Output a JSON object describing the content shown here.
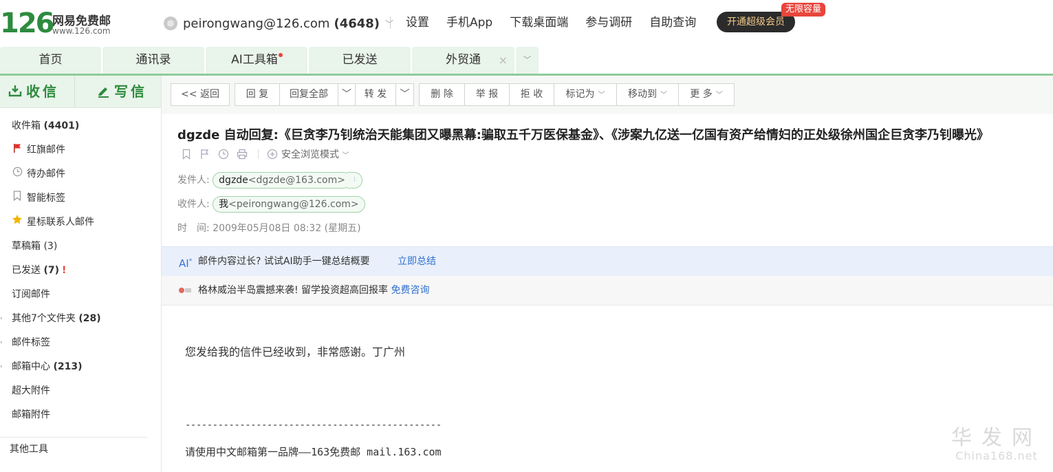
{
  "logo": {
    "number": "126",
    "name": "网易免费邮",
    "url": "www.126.com"
  },
  "account": {
    "email": "peirongwang@126.com",
    "count": "(4648)"
  },
  "top_links": [
    "设置",
    "手机App",
    "下载桌面端",
    "参与调研",
    "自助查询"
  ],
  "vip": {
    "button": "开通超级会员",
    "badge": "无限容量"
  },
  "tabs": [
    {
      "label": "首页"
    },
    {
      "label": "通讯录"
    },
    {
      "label": "AI工具箱"
    },
    {
      "label": "已发送"
    },
    {
      "label": "外贸通"
    }
  ],
  "sidebar": {
    "receive": "收信",
    "write": "写信",
    "items": [
      {
        "label": "收件箱",
        "count": "(4401)"
      },
      {
        "label": "红旗邮件"
      },
      {
        "label": "待办邮件"
      },
      {
        "label": "智能标签"
      },
      {
        "label": "星标联系人邮件"
      },
      {
        "label": "草稿箱",
        "count": "(3)"
      },
      {
        "label": "已发送",
        "count": "(7)",
        "flag": "!"
      },
      {
        "label": "订阅邮件"
      },
      {
        "label": "其他7个文件夹",
        "count": "(28)"
      },
      {
        "label": "邮件标签"
      },
      {
        "label": "邮箱中心",
        "count": "(213)"
      },
      {
        "label": "超大附件"
      },
      {
        "label": "邮箱附件"
      }
    ],
    "tools": "其他工具"
  },
  "toolbar": {
    "back": "<< 返回",
    "reply": "回 复",
    "reply_all": "回复全部",
    "forward": "转 发",
    "delete": "删 除",
    "report": "举 报",
    "reject": "拒 收",
    "mark_as": "标记为",
    "move_to": "移动到",
    "more": "更 多"
  },
  "email": {
    "subject": "dgzde 自动回复:《巨贪李乃钊统治天能集团又曝黑幕:骗取五千万医保基金》、《涉案九亿送一亿国有资产给情妇的正处级徐州国企巨贪李乃钊曝光》",
    "safe_mode": "安全浏览模式",
    "from_label": "发件人:",
    "from_name": "dgzde",
    "from_addr": "<dgzde@163.com>",
    "to_label": "收件人:",
    "to_name": "我",
    "to_addr": "<peirongwang@126.com>",
    "time_label": "时　间:",
    "time": "2009年05月08日 08:32 (星期五)",
    "body": "您发给我的信件已经收到，非常感谢。丁广州",
    "dashes": "-----------------------------------------------",
    "signature": "请使用中文邮箱第一品牌——163免费邮 mail.163.com"
  },
  "ai_bar": {
    "icon": "AI",
    "text": "邮件内容过长? 试试AI助手一键总结概要",
    "link": "立即总结"
  },
  "ad_bar": {
    "text": "格林威治半岛震撼来袭! 留学投资超高回报率 ",
    "link": "免费咨询"
  },
  "watermark": {
    "line1": "华发网",
    "line2": "China168.net"
  },
  "colors": {
    "brand_green": "#2e8b3e",
    "tab_bg": "#e9f4ea",
    "link_blue": "#2f6fd1",
    "alert_red": "#e8453c"
  }
}
